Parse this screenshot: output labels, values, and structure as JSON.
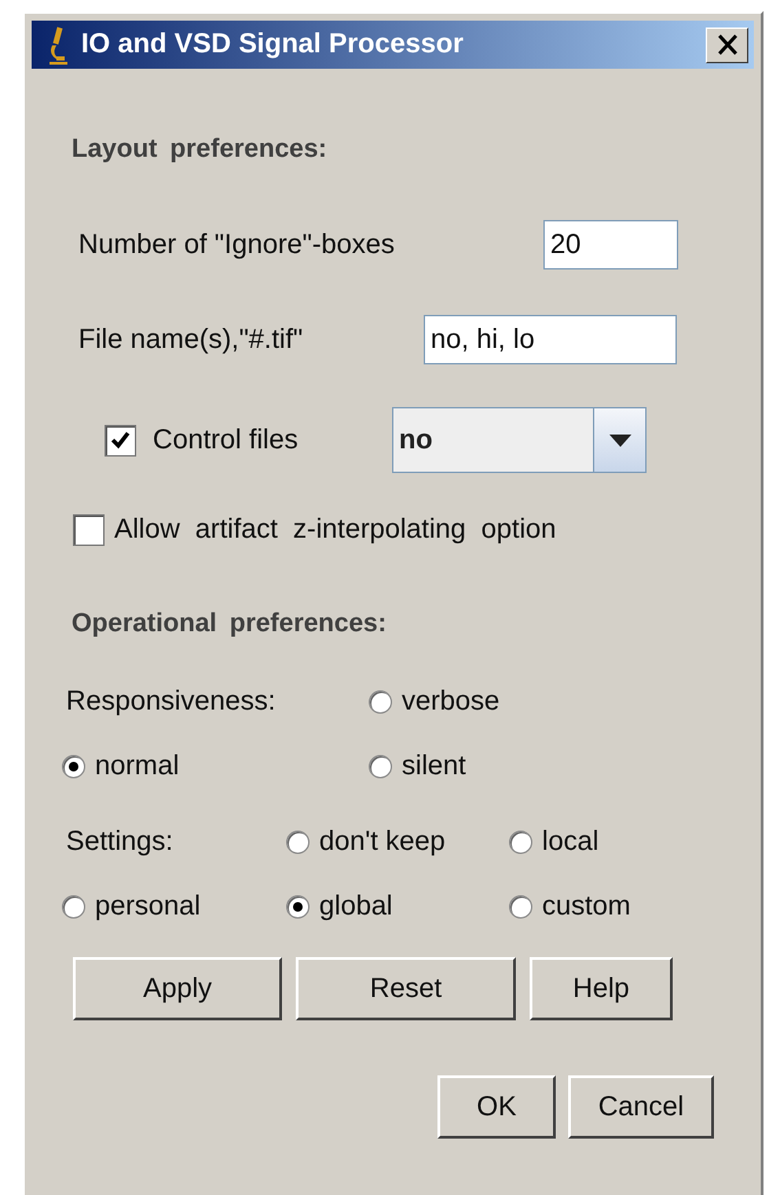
{
  "window": {
    "title": "IO and VSD Signal Processor"
  },
  "layout_preferences": {
    "heading": "Layout preferences:",
    "ignore_boxes": {
      "label": "Number of \"Ignore\"-boxes",
      "value": "20"
    },
    "file_names": {
      "label": "File name(s),\"#.tif\"",
      "value": "no, hi, lo"
    },
    "control_files": {
      "label": "Control files",
      "checked": true,
      "value": "no"
    },
    "allow_interpolation": {
      "label": "Allow  artifact  z-interpolating  option",
      "checked": false
    }
  },
  "operational_preferences": {
    "heading": "Operational preferences:",
    "responsiveness": {
      "label": "Responsiveness:",
      "options": [
        {
          "label": "verbose",
          "selected": false
        },
        {
          "label": "normal",
          "selected": true
        },
        {
          "label": "silent",
          "selected": false
        }
      ]
    },
    "settings": {
      "label": "Settings:",
      "options": [
        {
          "label": "don't keep",
          "selected": false
        },
        {
          "label": "local",
          "selected": false
        },
        {
          "label": "personal",
          "selected": false
        },
        {
          "label": "global",
          "selected": true
        },
        {
          "label": "custom",
          "selected": false
        }
      ]
    }
  },
  "buttons": [
    "Apply",
    "Reset",
    "Help"
  ],
  "dialog_buttons": [
    "OK",
    "Cancel"
  ]
}
